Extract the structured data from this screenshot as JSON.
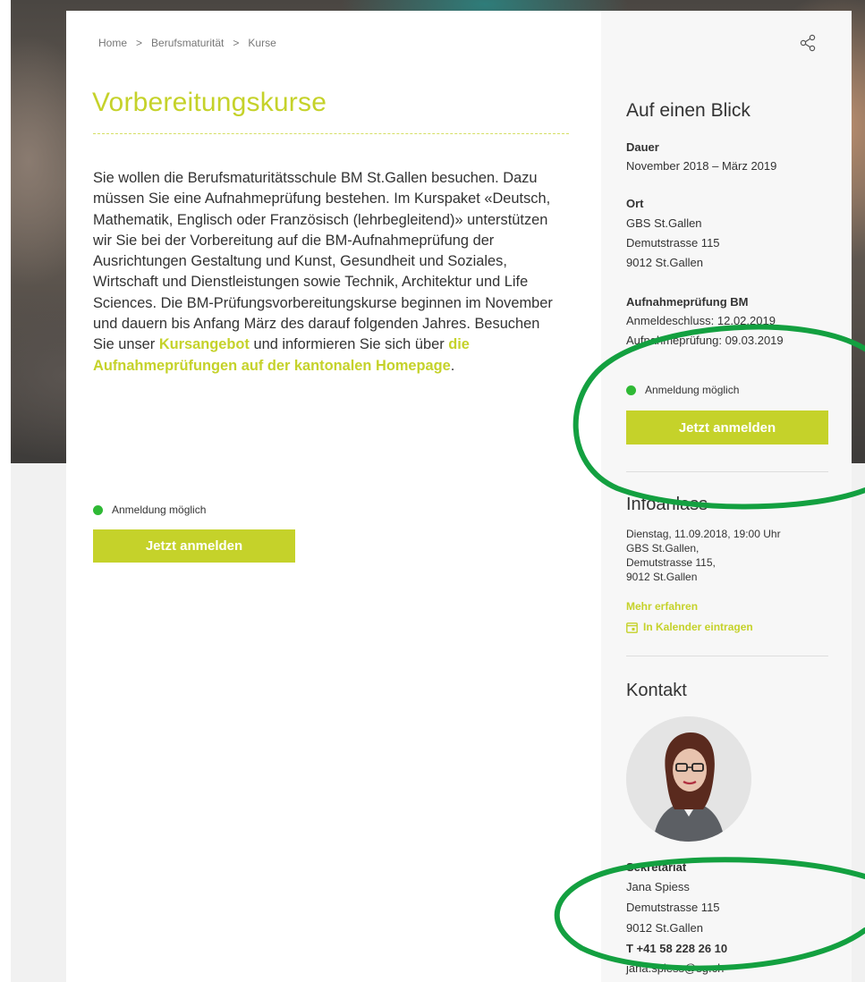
{
  "breadcrumb": {
    "home": "Home",
    "sep1": ">",
    "section": "Berufsmaturität",
    "sep2": ">",
    "current": "Kurse"
  },
  "page_title": "Vorbereitungskurse",
  "intro": {
    "text1": "Sie wollen die Berufsmaturitätsschule BM St.Gallen besuchen. Dazu müssen Sie eine Aufnahmeprüfung bestehen. Im Kurspaket «Deutsch, Mathematik, Englisch oder Französisch (lehrbegleitend)» unterstützen wir Sie bei der Vorbereitung auf die BM-Aufnahmeprüfung der Ausrichtungen Gestaltung und Kunst, Gesundheit und Soziales, Wirtschaft und Dienstleistungen sowie Technik, Architektur und Life Sciences. Die BM-Prüfungsvorbereitungskurse beginnen im November und dauern bis Anfang März des darauf folgenden Jahres. Besuchen Sie unser ",
    "link1": "Kursangebot",
    "text2": " und informieren Sie sich über ",
    "link2": "die Aufnahmeprüfungen auf der kantonalen Homepage",
    "text3": "."
  },
  "registration": {
    "status": "Anmeldung möglich",
    "button": "Jetzt anmelden"
  },
  "sidebar": {
    "glance_title": "Auf einen Blick",
    "duration_label": "Dauer",
    "duration_value": "November 2018 – März 2019",
    "place_label": "Ort",
    "place_line1": "GBS St.Gallen",
    "place_line2": "Demutstrasse 115",
    "place_line3": "9012 St.Gallen",
    "exam_label": "Aufnahmeprüfung BM",
    "exam_deadline": "Anmeldeschluss: 12.02.2019",
    "exam_date": "Aufnahmeprüfung: 09.03.2019",
    "status": "Anmeldung möglich",
    "button": "Jetzt anmelden",
    "info_title": "Infoanlass",
    "info_line1": "Dienstag, 11.09.2018, 19:00 Uhr",
    "info_line2": "GBS St.Gallen,",
    "info_line3": "Demutstrasse 115,",
    "info_line4": "9012 St.Gallen",
    "info_more": "Mehr erfahren",
    "info_calendar": "In Kalender eintragen",
    "contact_title": "Kontakt",
    "contact_role": "Sekretariat",
    "contact_name": "Jana Spiess",
    "contact_street": "Demutstrasse 115",
    "contact_city": "9012 St.Gallen",
    "contact_phone": "T +41 58 228 26 10",
    "contact_email": "jana.spiess@sg.ch"
  },
  "colors": {
    "accent": "#c5d22a",
    "status_green": "#2fb935",
    "annotation": "#13a040"
  },
  "icons": {
    "share": "share-icon",
    "calendar": "calendar-icon"
  }
}
